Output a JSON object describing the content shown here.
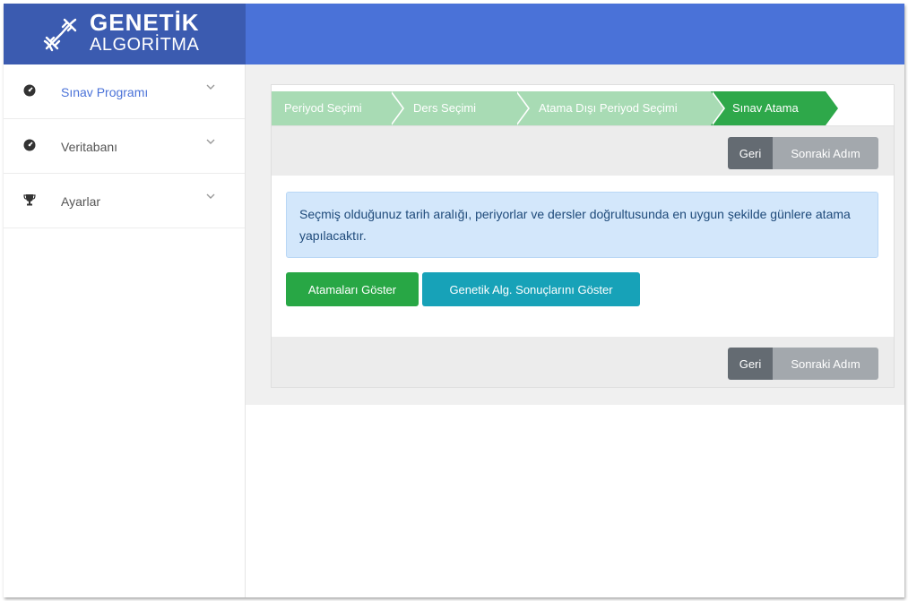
{
  "brand": {
    "title": "GENETİK",
    "subtitle": "ALGORİTMA",
    "logo_icon": "dna-icon"
  },
  "sidebar": {
    "items": [
      {
        "label": "Sınav Programı",
        "icon": "dashboard-icon"
      },
      {
        "label": "Veritabanı",
        "icon": "dashboard-icon"
      },
      {
        "label": "Ayarlar",
        "icon": "trophy-icon"
      }
    ]
  },
  "wizard": {
    "steps": [
      {
        "label": "Periyod Seçimi",
        "active": false
      },
      {
        "label": "Ders Seçimi",
        "active": false
      },
      {
        "label": "Atama Dışı Periyod Seçimi",
        "active": false
      },
      {
        "label": "Sınav Atama",
        "active": true
      }
    ],
    "back_label": "Geri",
    "next_label": "Sonraki Adım"
  },
  "alert": {
    "text": "Seçmiş olduğunuz tarih aralığı, periyorlar ve dersler doğrultusunda en uygun şekilde günlere atama yapılacaktır."
  },
  "buttons": {
    "show_assignments": "Atamaları Göster",
    "show_genetic_results": "Genetik Alg. Sonuçlarını Göster"
  },
  "colors": {
    "brand_bg": "#3b5bb0",
    "topbar": "#4a72d8",
    "step_active": "#2ea84a",
    "step_inactive": "#a8dbb4",
    "alert_bg": "#d3e7fb",
    "btn_green": "#28a745",
    "btn_teal": "#17a2b8"
  }
}
